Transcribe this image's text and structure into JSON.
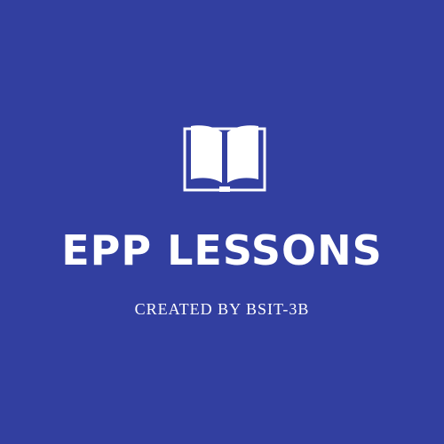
{
  "colors": {
    "background": "#323fa0",
    "foreground": "#ffffff"
  },
  "logo": {
    "icon": "open-book-icon"
  },
  "title": "EPP LESSONS",
  "subtitle": "CREATED BY BSIT-3B"
}
